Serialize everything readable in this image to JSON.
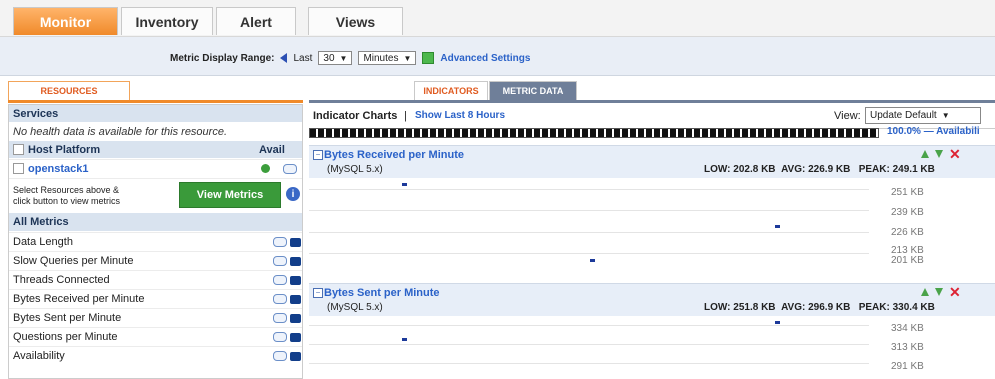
{
  "top_tabs": [
    {
      "label": "Monitor",
      "active": true
    },
    {
      "label": "Inventory",
      "active": false
    },
    {
      "label": "Alert",
      "active": false
    },
    {
      "label": "Views",
      "active": false
    }
  ],
  "metric_range": {
    "label": "Metric Display Range:",
    "last_label": "Last",
    "value": "30",
    "unit": "Minutes",
    "advanced": "Advanced Settings"
  },
  "left_panel": {
    "tab": "RESOURCES",
    "services_title": "Services",
    "services_msg": "No health data is available for this resource.",
    "host_platform": "Host Platform",
    "avail_header": "Avail",
    "host": "openstack1",
    "select_text_1": "Select Resources above &",
    "select_text_2": "click button to view metrics",
    "view_metrics_btn": "View Metrics",
    "info_label": "i",
    "all_metrics_title": "All Metrics",
    "metrics": [
      "Data Length",
      "Slow Queries per Minute",
      "Threads Connected",
      "Bytes Received per Minute",
      "Bytes Sent per Minute",
      "Questions per Minute",
      "Availability"
    ]
  },
  "right_panel": {
    "tabs": [
      "INDICATORS",
      "METRIC DATA"
    ],
    "indicator_charts": "Indicator Charts",
    "sep": "|",
    "show_last": "Show Last 8 Hours",
    "view_label": "View:",
    "view_value": "Update Default",
    "availability_text": "100.0% — Availabili",
    "charts": [
      {
        "title": "Bytes Received per Minute",
        "subtitle": "(MySQL 5.x)",
        "low_label": "LOW:",
        "low": "202.8 KB",
        "avg_label": "AVG:",
        "avg": "226.9 KB",
        "peak_label": "PEAK:",
        "peak": "249.1 KB",
        "ticks": [
          "251 KB",
          "239 KB",
          "226 KB",
          "213 KB",
          "201 KB"
        ]
      },
      {
        "title": "Bytes Sent per Minute",
        "subtitle": "(MySQL 5.x)",
        "low_label": "LOW:",
        "low": "251.8 KB",
        "avg_label": "AVG:",
        "avg": "296.9 KB",
        "peak_label": "PEAK:",
        "peak": "330.4 KB",
        "ticks": [
          "334 KB",
          "313 KB",
          "291 KB"
        ]
      }
    ]
  },
  "icons": {
    "chart_toggle": "−",
    "close": "✕"
  }
}
